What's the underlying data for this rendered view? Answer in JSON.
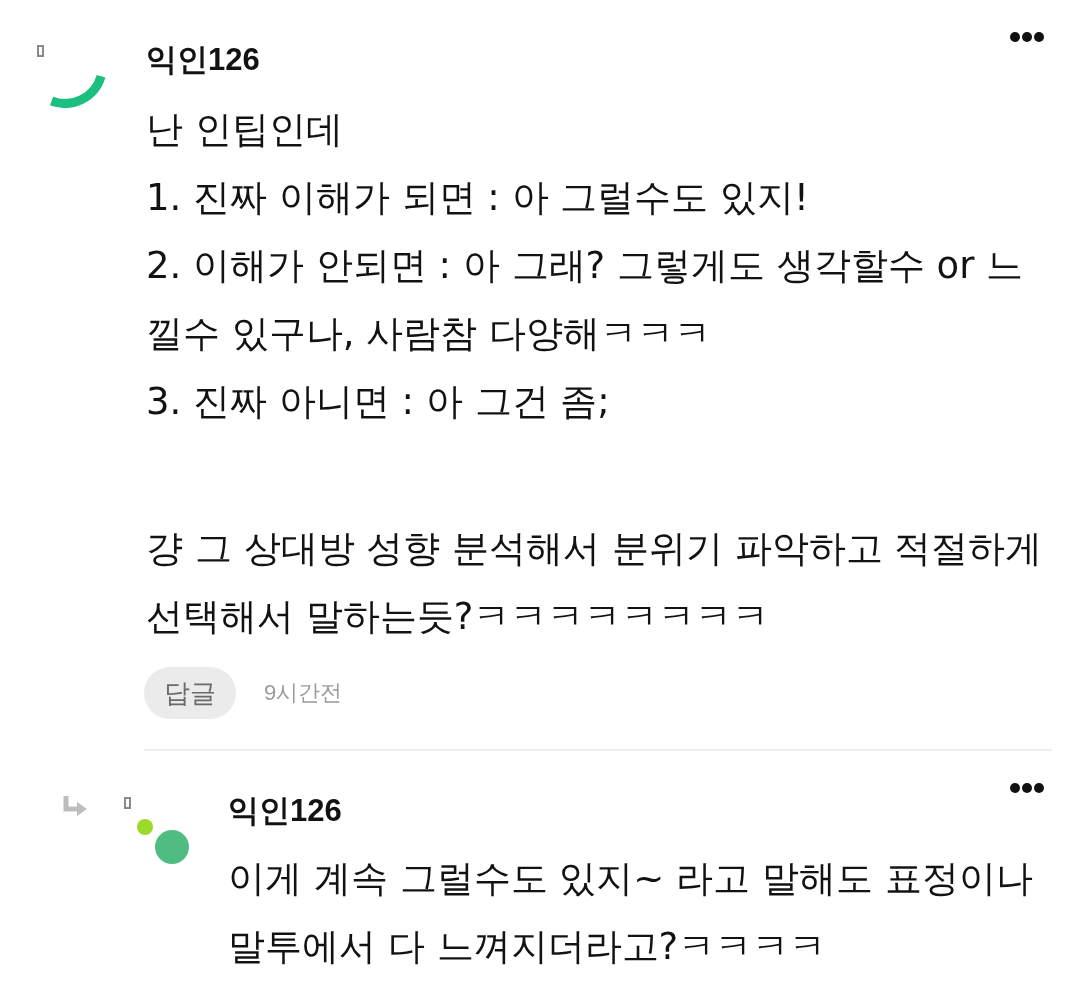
{
  "comments": [
    {
      "kind": "comment",
      "author": "익인126",
      "blocks": [
        [
          "난 인팁인데",
          "1. 진짜 이해가 되면 : 아 그럴수도 있지!",
          "2. 이해가 안되면 : 아 그래? 그렇게도 생각할수 or 느낄수 있구나, 사람참 다양해ㅋㅋㅋ",
          "3. 진짜 아니면 : 아 그건 좀;"
        ],
        [
          "걍 그 상대방 성향 분석해서 분위기 파악하고 적절하게 선택해서 말하는듯?ㅋㅋㅋㅋㅋㅋㅋㅋ"
        ]
      ],
      "reply_button": "답글",
      "time": "9시간전"
    },
    {
      "kind": "reply",
      "author": "익인126",
      "blocks": [
        [
          "이게 계속 그럴수도 있지~ 라고 말해도 표정이나 말투에서 다 느껴지더라고?ㅋㅋㅋㅋ"
        ]
      ]
    }
  ]
}
